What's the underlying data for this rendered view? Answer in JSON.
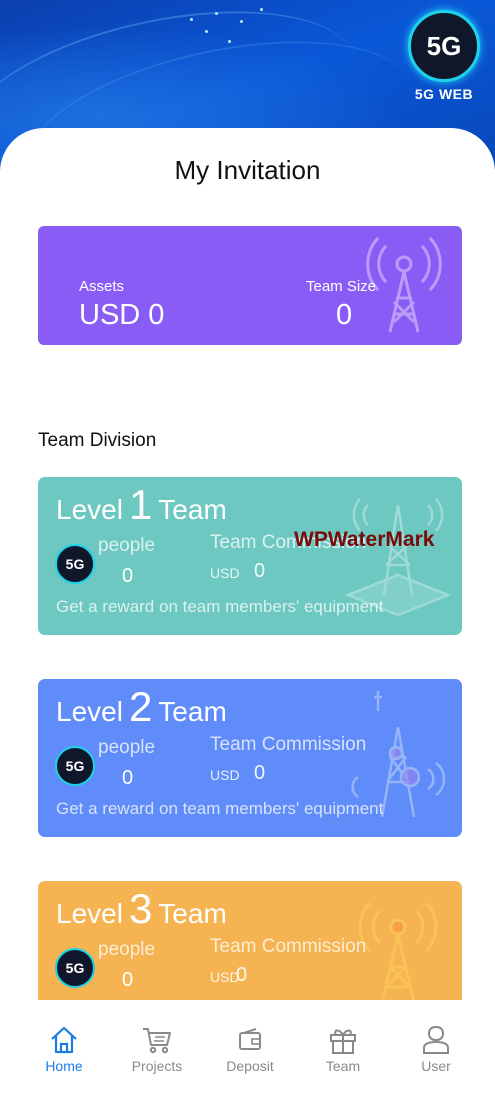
{
  "brand": {
    "logo_text": "5G",
    "name": "5G WEB"
  },
  "page": {
    "title": "My Invitation"
  },
  "assets_card": {
    "assets_label": "Assets",
    "assets_value": "USD 0",
    "team_size_label": "Team Size",
    "team_size_value": "0",
    "color": "#8a5cf6"
  },
  "team_division": {
    "title": "Team Division",
    "levels": [
      {
        "prefix": "Level",
        "num": "1",
        "suffix": "Team",
        "people_label": "people",
        "people_value": "0",
        "commission_label": "Team Commission",
        "currency": "USD",
        "commission_value": "0",
        "reward_text": "Get a reward on team members' equipment",
        "color": "#6cc8c0"
      },
      {
        "prefix": "Level",
        "num": "2",
        "suffix": "Team",
        "people_label": "people",
        "people_value": "0",
        "commission_label": "Team Commission",
        "currency": "USD",
        "commission_value": "0",
        "reward_text": "Get a reward on team members' equipment",
        "color": "#5f8cf8"
      },
      {
        "prefix": "Level",
        "num": "3",
        "suffix": "Team",
        "people_label": "people",
        "people_value": "0",
        "commission_label": "Team Commission",
        "currency": "USD",
        "commission_value": "0",
        "reward_text": "",
        "color": "#f5b351"
      }
    ]
  },
  "watermark": "WPWaterMark",
  "tabbar": {
    "items": [
      {
        "label": "Home",
        "icon": "home-icon",
        "active": true
      },
      {
        "label": "Projects",
        "icon": "cart-icon",
        "active": false
      },
      {
        "label": "Deposit",
        "icon": "wallet-icon",
        "active": false
      },
      {
        "label": "Team",
        "icon": "gift-icon",
        "active": false
      },
      {
        "label": "User",
        "icon": "user-icon",
        "active": false
      }
    ],
    "active_color": "#1c7be8",
    "inactive_color": "#8a8a8a"
  }
}
